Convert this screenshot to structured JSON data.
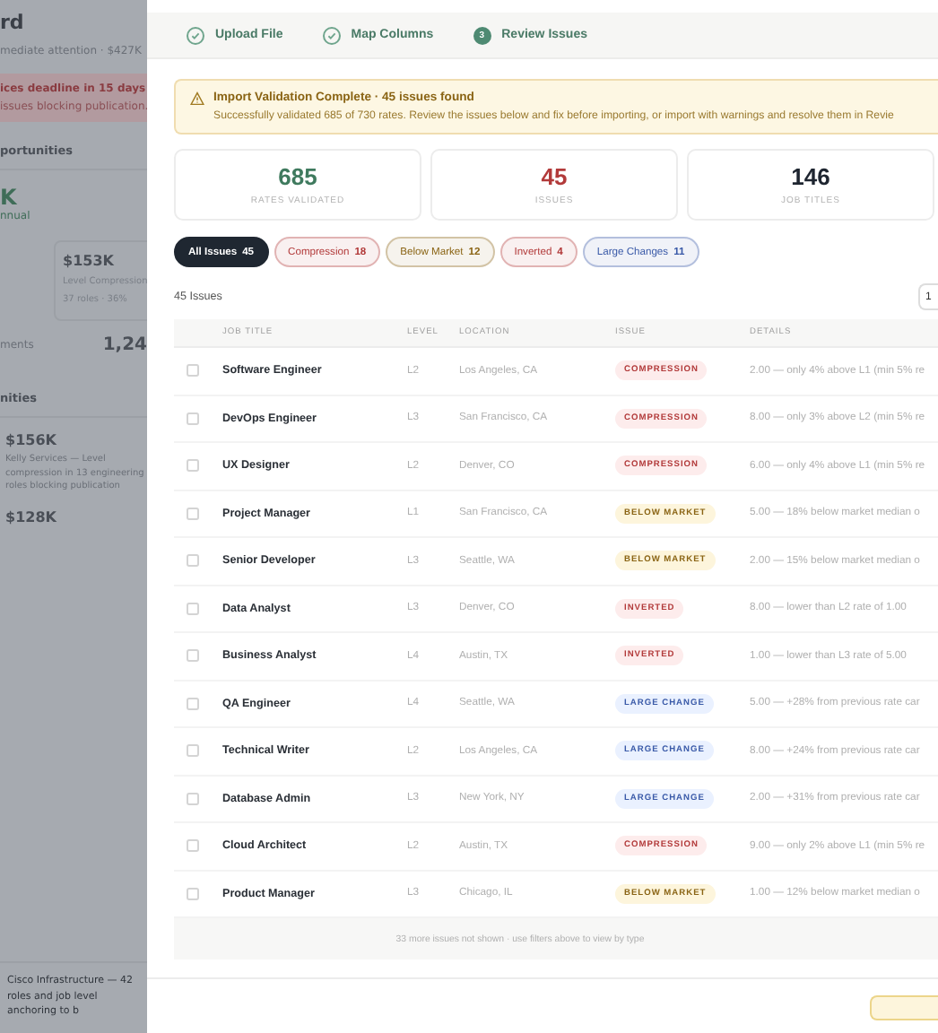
{
  "background": {
    "title": "rd",
    "subtitle": "mediate attention · $427K",
    "alert": {
      "title": "ices deadline in 15 days",
      "text": "issues blocking publication."
    },
    "section_1": "portunities",
    "big_value": "K",
    "big_caption": "nnual",
    "card": {
      "value": "$153K",
      "label": "Level Compression",
      "meta": "37 roles · 36%"
    },
    "stat_label": "ments",
    "stat_value": "1,24",
    "section_2": "nities",
    "items": [
      {
        "value": "$156K",
        "text": "Kelly Services — Level compression in 13 engineering roles blocking publication"
      },
      {
        "value": "$128K"
      }
    ],
    "footer_text": "Cisco Infrastructure — 42 roles and job level anchoring to b"
  },
  "steps": [
    {
      "label": "Upload File",
      "completed": true
    },
    {
      "label": "Map Columns",
      "completed": true
    },
    {
      "label": "Review Issues",
      "completed": false,
      "number": "3"
    }
  ],
  "alert": {
    "title": "Import Validation Complete · 45 issues found",
    "text": "Successfully validated 685 of 730 rates. Review the issues below and fix before importing, or import with warnings and resolve them in Revie"
  },
  "stats": [
    {
      "value": "685",
      "label": "RATES VALIDATED",
      "color": "#3f7a5e"
    },
    {
      "value": "45",
      "label": "ISSUES",
      "color": "#b23a3a"
    },
    {
      "value": "146",
      "label": "JOB TITLES",
      "color": "#1e2530"
    }
  ],
  "filters": [
    {
      "label": "All Issues",
      "count": "45",
      "color": "#1f2731",
      "selected": true
    },
    {
      "label": "Compression",
      "count": "18",
      "color": "#b23a3a",
      "selected": false
    },
    {
      "label": "Below Market",
      "count": "12",
      "color": "#8a6414",
      "selected": false
    },
    {
      "label": "Inverted",
      "count": "4",
      "color": "#b23a3a",
      "selected": false
    },
    {
      "label": "Large Changes",
      "count": "11",
      "color": "#3a5aa8",
      "selected": false
    }
  ],
  "issue_count": "45 Issues",
  "side_button": "1",
  "table": {
    "columns": [
      "JOB TITLE",
      "LEVEL",
      "LOCATION",
      "ISSUE",
      "DETAILS"
    ],
    "rows": [
      {
        "checked": false,
        "title": "Software Engineer",
        "level": "L2",
        "location": "Los Angeles, CA",
        "issue": "COMPRESSION",
        "kind": "compression",
        "details": "2.00 — only 4% above L1 (min 5% re"
      },
      {
        "checked": false,
        "title": "DevOps Engineer",
        "level": "L3",
        "location": "San Francisco, CA",
        "issue": "COMPRESSION",
        "kind": "compression",
        "details": "8.00 — only 3% above L2 (min 5% re"
      },
      {
        "checked": false,
        "title": "UX Designer",
        "level": "L2",
        "location": "Denver, CO",
        "issue": "COMPRESSION",
        "kind": "compression",
        "details": "6.00 — only 4% above L1 (min 5% re"
      },
      {
        "checked": false,
        "title": "Project Manager",
        "level": "L1",
        "location": "San Francisco, CA",
        "issue": "BELOW MARKET",
        "kind": "below",
        "details": "5.00 — 18% below market median o"
      },
      {
        "checked": false,
        "title": "Senior Developer",
        "level": "L3",
        "location": "Seattle, WA",
        "issue": "BELOW MARKET",
        "kind": "below",
        "details": "2.00 — 15% below market median o"
      },
      {
        "checked": false,
        "title": "Data Analyst",
        "level": "L3",
        "location": "Denver, CO",
        "issue": "INVERTED",
        "kind": "inverted",
        "details": "8.00 — lower than L2 rate of 1.00"
      },
      {
        "checked": false,
        "title": "Business Analyst",
        "level": "L4",
        "location": "Austin, TX",
        "issue": "INVERTED",
        "kind": "inverted",
        "details": "1.00 — lower than L3 rate of 5.00"
      },
      {
        "checked": false,
        "title": "QA Engineer",
        "level": "L4",
        "location": "Seattle, WA",
        "issue": "LARGE CHANGE",
        "kind": "large",
        "details": "5.00 — +28% from previous rate car"
      },
      {
        "checked": false,
        "title": "Technical Writer",
        "level": "L2",
        "location": "Los Angeles, CA",
        "issue": "LARGE CHANGE",
        "kind": "large",
        "details": "8.00 — +24% from previous rate car"
      },
      {
        "checked": false,
        "title": "Database Admin",
        "level": "L3",
        "location": "New York, NY",
        "issue": "LARGE CHANGE",
        "kind": "large",
        "details": "2.00 — +31% from previous rate car"
      },
      {
        "checked": false,
        "title": "Cloud Architect",
        "level": "L2",
        "location": "Austin, TX",
        "issue": "COMPRESSION",
        "kind": "compression",
        "details": "9.00 — only 2% above L1 (min 5% re"
      },
      {
        "checked": false,
        "title": "Product Manager",
        "level": "L3",
        "location": "Chicago, IL",
        "issue": "BELOW MARKET",
        "kind": "below",
        "details": "1.00 — 12% below market median o"
      }
    ],
    "more_note": "33 more issues not shown · use filters above to view by type"
  }
}
